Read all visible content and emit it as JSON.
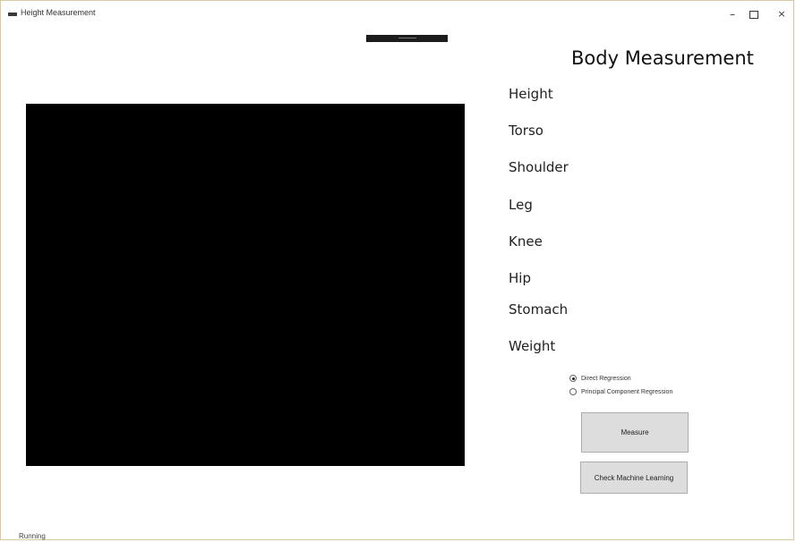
{
  "window": {
    "title": "Height Measurement",
    "controls": {
      "minimize": "–",
      "close": "×"
    }
  },
  "panel": {
    "title": "Body Measurement",
    "labels": [
      "Height",
      "Torso",
      "Shoulder",
      "Leg",
      "Knee",
      "Hip",
      "Stomach",
      "Weight"
    ]
  },
  "regression": {
    "options": [
      {
        "label": "Direct Regression",
        "selected": true
      },
      {
        "label": "Principal Component Regression",
        "selected": false
      }
    ]
  },
  "buttons": {
    "measure": "Measure",
    "check_ml": "Check Machine Learning"
  },
  "status": {
    "text": "Running"
  },
  "colors": {
    "camera_background": "#000000",
    "button_face": "#dddddd"
  }
}
